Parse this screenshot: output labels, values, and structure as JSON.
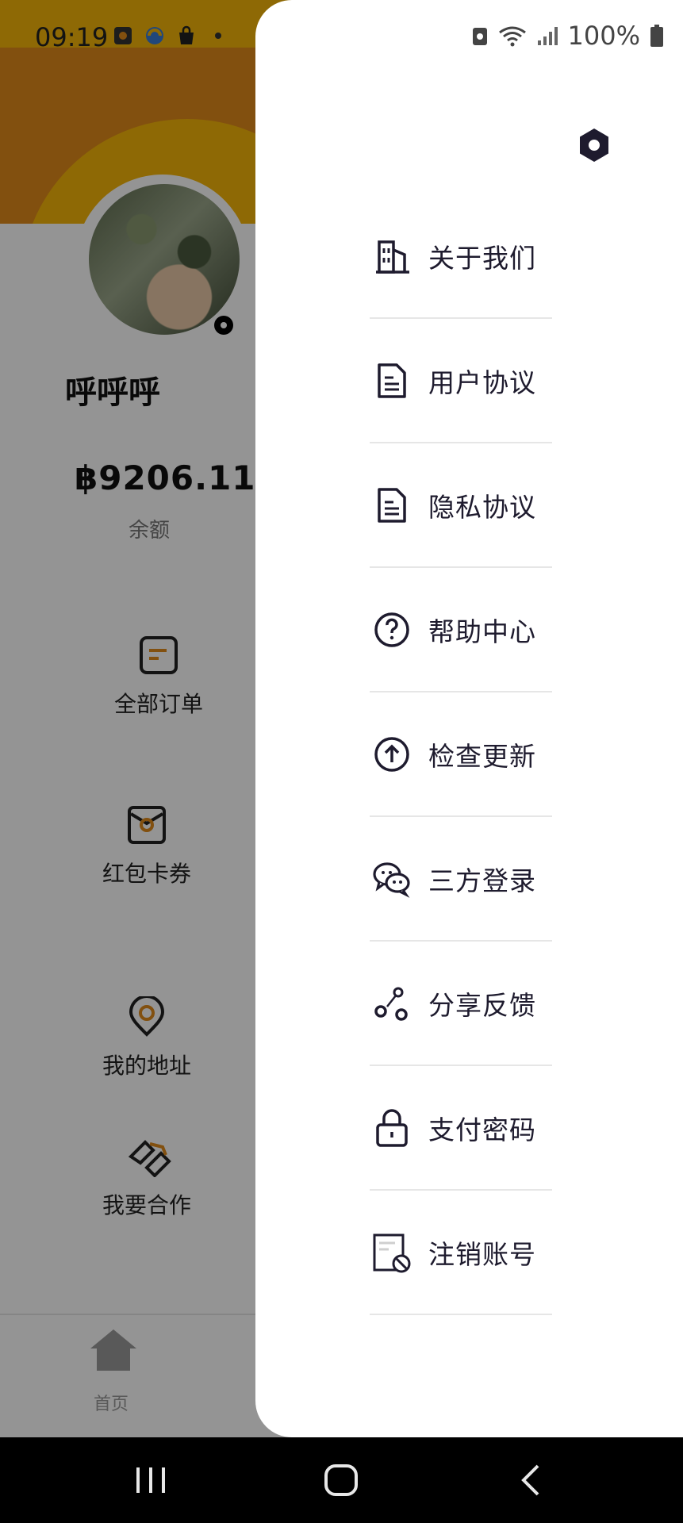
{
  "status_bar": {
    "time": "09:19",
    "battery_percent": "100%"
  },
  "profile": {
    "name": "呼呼呼",
    "balance": "฿9206.11",
    "balance_label": "余额"
  },
  "menu": [
    {
      "label": "全部订单",
      "icon": "order-list-icon"
    },
    {
      "label": "红包卡券",
      "icon": "coupon-icon"
    },
    {
      "label": "我的地址",
      "icon": "location-pin-icon"
    },
    {
      "label": "我要合作",
      "icon": "handshake-icon"
    }
  ],
  "bottom_tab": {
    "label": "首页",
    "icon": "home-icon"
  },
  "drawer": {
    "items": [
      {
        "label": "关于我们",
        "icon": "building-icon"
      },
      {
        "label": "用户协议",
        "icon": "document-icon"
      },
      {
        "label": "隐私协议",
        "icon": "document-icon"
      },
      {
        "label": "帮助中心",
        "icon": "question-circle-icon"
      },
      {
        "label": "检查更新",
        "icon": "upload-circle-icon"
      },
      {
        "label": "三方登录",
        "icon": "wechat-icon"
      },
      {
        "label": "分享反馈",
        "icon": "share-icon"
      },
      {
        "label": "支付密码",
        "icon": "lock-icon"
      },
      {
        "label": "注销账号",
        "icon": "deactivate-account-icon"
      }
    ]
  },
  "colors": {
    "brand_orange": "#e08a1a",
    "brand_yellow": "#f4b50a",
    "drawer_text": "#1e1b2e"
  }
}
